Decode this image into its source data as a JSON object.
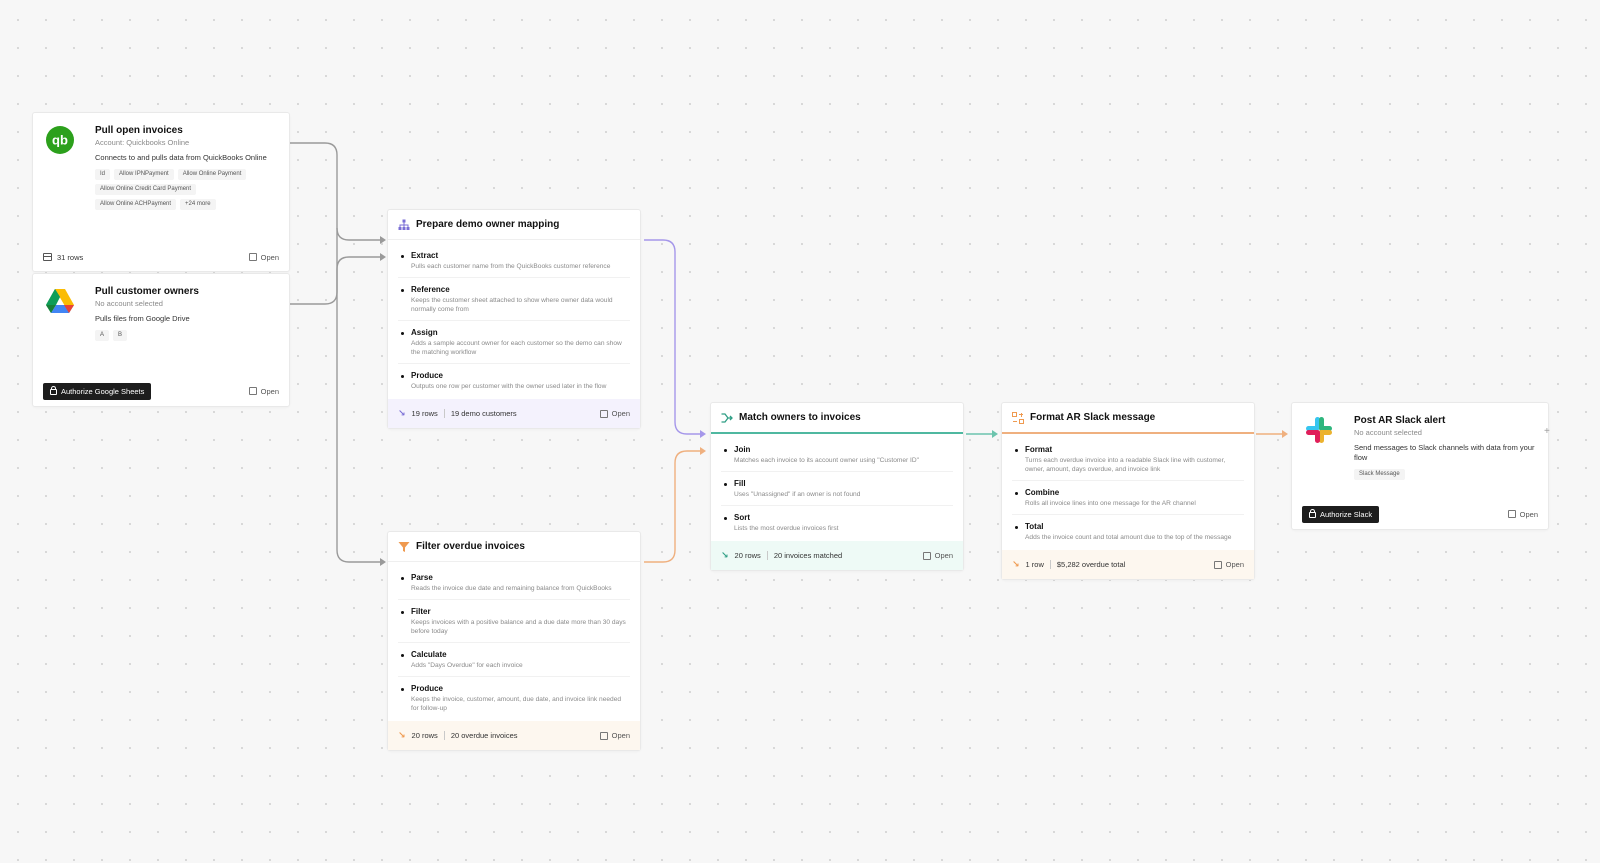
{
  "colors": {
    "purple": "#9b8de6",
    "orange": "#efb07f",
    "teal": "#4fb8a0",
    "gray_edge": "#9a9a9a",
    "quickbooks_green": "#2ca01c"
  },
  "nodes": {
    "quickbooks": {
      "icon": "quickbooks-logo-icon",
      "title": "Pull open invoices",
      "subtitle": "Account: Quickbooks Online",
      "description": "Connects to and pulls data from QuickBooks Online",
      "chips": [
        "Id",
        "Allow IPNPayment",
        "Allow Online Payment",
        "Allow Online Credit Card Payment",
        "Allow Online ACHPayment",
        "+24 more"
      ],
      "rows": "31 rows",
      "open_label": "Open"
    },
    "gdrive": {
      "icon": "google-drive-logo-icon",
      "title": "Pull customer owners",
      "subtitle": "No account selected",
      "description": "Pulls files from Google Drive",
      "chips": [
        "A",
        "B"
      ],
      "auth_label": "Authorize Google Sheets",
      "open_label": "Open"
    },
    "prepare": {
      "icon": "hierarchy-icon",
      "title": "Prepare demo owner mapping",
      "steps": [
        {
          "name": "Extract",
          "desc": "Pulls each customer name from the QuickBooks customer reference"
        },
        {
          "name": "Reference",
          "desc": "Keeps the customer sheet attached to show where owner data would normally come from"
        },
        {
          "name": "Assign",
          "desc": "Adds a sample account owner for each customer so the demo can show the matching workflow"
        },
        {
          "name": "Produce",
          "desc": "Outputs one row per customer with the owner used later in the flow"
        }
      ],
      "rows": "19 rows",
      "summary": "19 demo customers",
      "open_label": "Open"
    },
    "filter": {
      "icon": "filter-icon",
      "title": "Filter overdue invoices",
      "steps": [
        {
          "name": "Parse",
          "desc": "Reads the invoice due date and remaining balance from QuickBooks"
        },
        {
          "name": "Filter",
          "desc": "Keeps invoices with a positive balance and a due date more than 30 days before today"
        },
        {
          "name": "Calculate",
          "desc": "Adds \"Days Overdue\" for each invoice"
        },
        {
          "name": "Produce",
          "desc": "Keeps the invoice, customer, amount, due date, and invoice link needed for follow-up"
        }
      ],
      "rows": "20 rows",
      "summary": "20 overdue invoices",
      "open_label": "Open"
    },
    "match": {
      "icon": "merge-icon",
      "title": "Match owners to invoices",
      "steps": [
        {
          "name": "Join",
          "desc": "Matches each invoice to its account owner using \"Customer ID\""
        },
        {
          "name": "Fill",
          "desc": "Uses \"Unassigned\" if an owner is not found"
        },
        {
          "name": "Sort",
          "desc": "Lists the most overdue invoices first"
        }
      ],
      "rows": "20 rows",
      "summary": "20 invoices matched",
      "open_label": "Open"
    },
    "format": {
      "icon": "format-icon",
      "title": "Format AR Slack message",
      "steps": [
        {
          "name": "Format",
          "desc": "Turns each overdue invoice into a readable Slack line with customer, owner, amount, days overdue, and invoice link"
        },
        {
          "name": "Combine",
          "desc": "Rolls all invoice lines into one message for the AR channel"
        },
        {
          "name": "Total",
          "desc": "Adds the invoice count and total amount due to the top of the message"
        }
      ],
      "rows": "1 row",
      "summary": "$5,282 overdue total",
      "open_label": "Open"
    },
    "slack": {
      "icon": "slack-logo-icon",
      "title": "Post AR Slack alert",
      "subtitle": "No account selected",
      "description": "Send messages to Slack channels with data from your flow",
      "chips": [
        "Slack Message"
      ],
      "auth_label": "Authorize Slack",
      "open_label": "Open"
    }
  }
}
